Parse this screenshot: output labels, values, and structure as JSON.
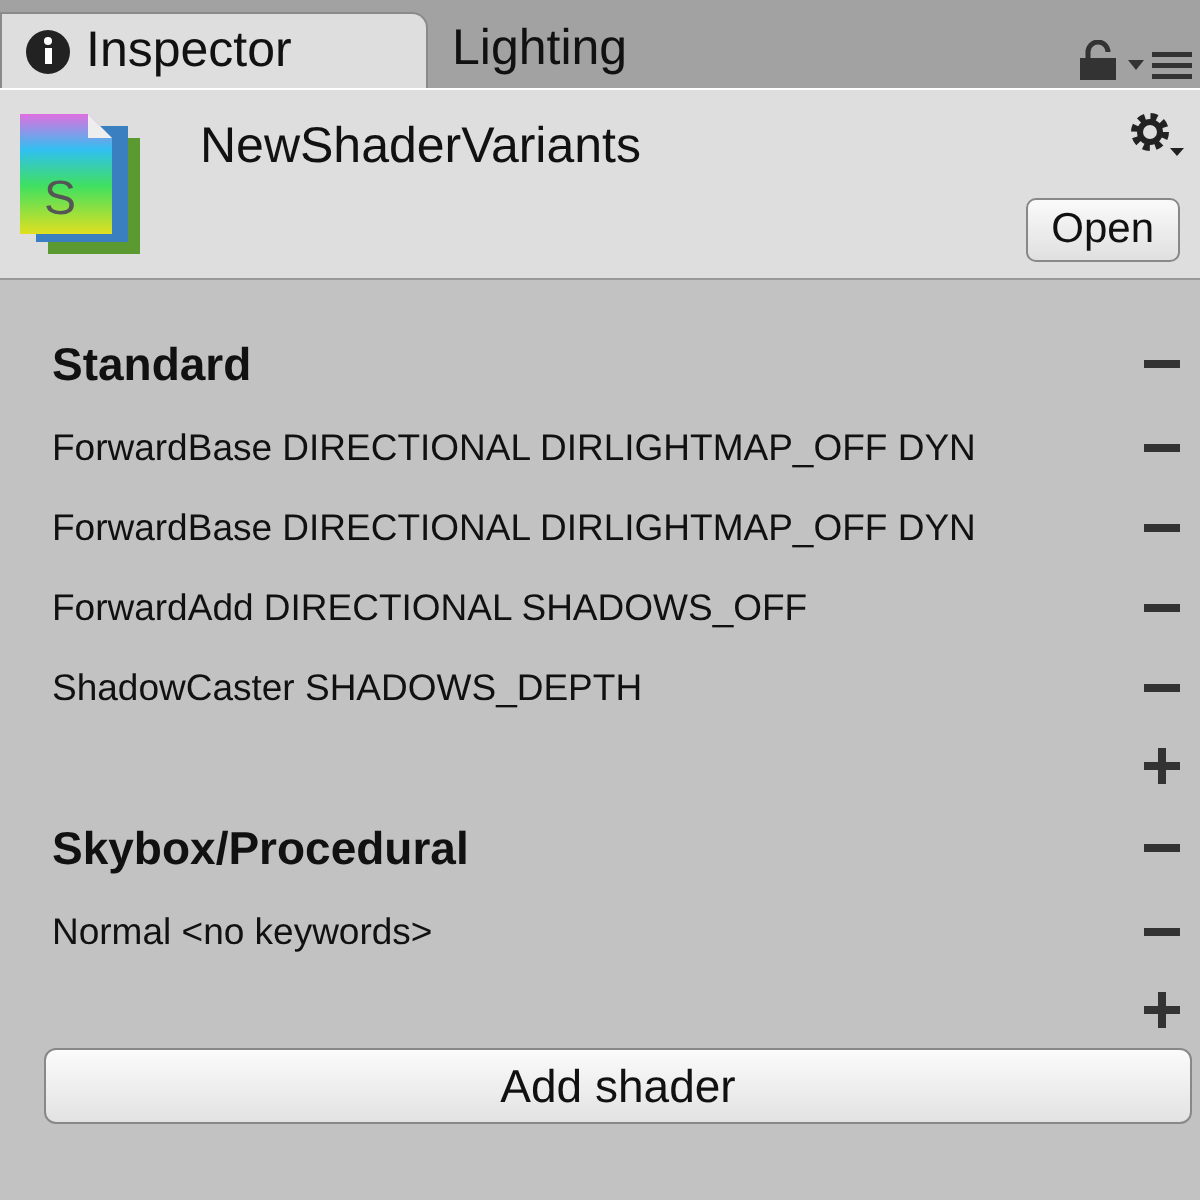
{
  "tabs": [
    {
      "label": "Inspector",
      "selected": true
    },
    {
      "label": "Lighting",
      "selected": false
    }
  ],
  "asset": {
    "name": "NewShaderVariants",
    "icon_letter": "S",
    "open_button": "Open"
  },
  "shaders": [
    {
      "name": "Standard",
      "variants": [
        "ForwardBase DIRECTIONAL DIRLIGHTMAP_OFF DYN",
        "ForwardBase DIRECTIONAL DIRLIGHTMAP_OFF DYN",
        "ForwardAdd DIRECTIONAL SHADOWS_OFF",
        "ShadowCaster SHADOWS_DEPTH"
      ]
    },
    {
      "name": "Skybox/Procedural",
      "variants": [
        "Normal <no keywords>"
      ]
    }
  ],
  "add_button": "Add shader"
}
